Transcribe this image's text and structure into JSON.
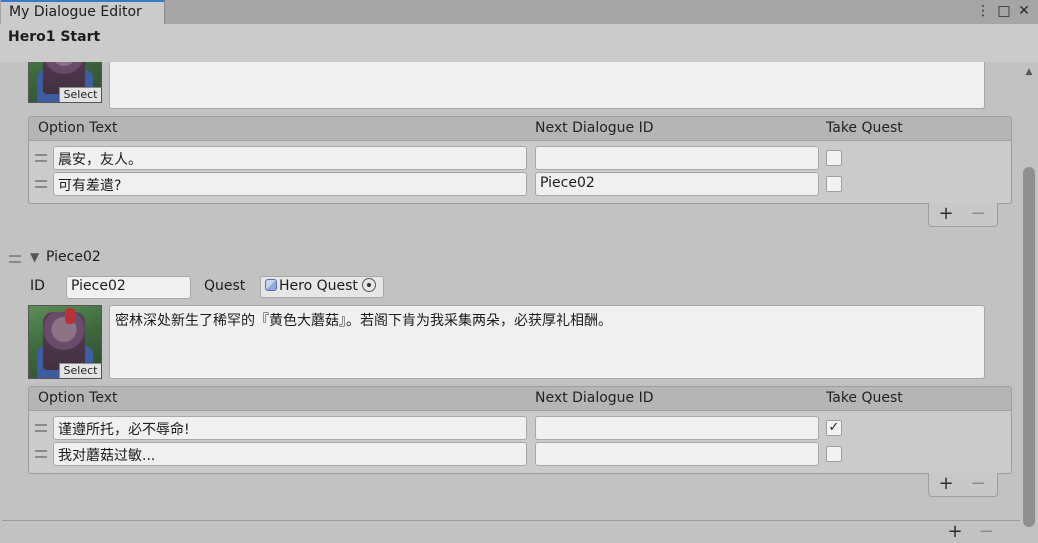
{
  "window": {
    "tab_title": "My Dialogue Editor",
    "menu_icon": "⋮",
    "maximize_icon": "□",
    "close_icon": "✕",
    "header_title": "Hero1 Start"
  },
  "portrait_select_label": "Select",
  "option_list_headers": {
    "option_text": "Option Text",
    "next_dialogue_id": "Next Dialogue ID",
    "take_quest": "Take Quest"
  },
  "piece1": {
    "text": "",
    "options": [
      {
        "text": "晨安，友人。",
        "next_id": "",
        "take_quest": false
      },
      {
        "text": "可有差遣?",
        "next_id": "Piece02",
        "take_quest": false
      }
    ]
  },
  "piece2": {
    "foldout_label": "Piece02",
    "id_label": "ID",
    "id_value": "Piece02",
    "quest_label": "Quest",
    "quest_value": "Hero Quest",
    "text": "密林深处新生了稀罕的『黄色大蘑菇』。若阁下肯为我采集两朵，必获厚礼相酬。",
    "options": [
      {
        "text": "谨遵所托，必不辱命!",
        "next_id": "",
        "take_quest": true
      },
      {
        "text": "我对蘑菇过敏...",
        "next_id": "",
        "take_quest": false
      }
    ]
  },
  "list_controls": {
    "add": "+",
    "remove": "−"
  },
  "icons": {
    "foldout": "▼",
    "checkmark": "✓",
    "scroll_up": "▲"
  },
  "colors": {
    "background": "#c2c2c2",
    "tab_accent": "#3a79c9",
    "field_bg": "#f0f0f0"
  }
}
